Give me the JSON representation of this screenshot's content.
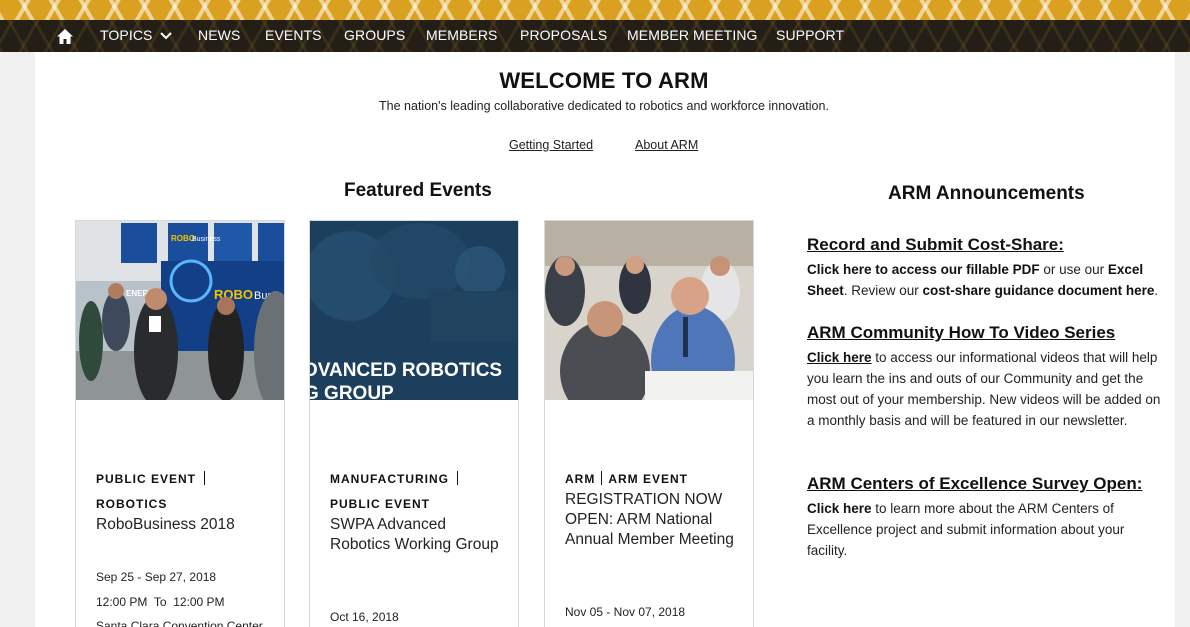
{
  "nav": {
    "items": [
      "TOPICS",
      "NEWS",
      "EVENTS",
      "GROUPS",
      "MEMBERS",
      "PROPOSALS",
      "MEMBER MEETING",
      "SUPPORT"
    ],
    "home_icon": "home-icon",
    "dropdown_icon": "chevron-down-icon"
  },
  "hero": {
    "title": "WELCOME TO ARM",
    "tagline": "The nation's leading collaborative dedicated to robotics and workforce innovation.",
    "links": [
      "Getting Started",
      "About ARM"
    ]
  },
  "featured": {
    "title": "Featured Events",
    "cards": [
      {
        "tags": [
          "PUBLIC EVENT",
          "ROBOTICS"
        ],
        "title": "RoboBusiness 2018",
        "dates": "Sep 25 - Sep 27, 2018",
        "time_start": "12:00 PM",
        "time_to": "To",
        "time_end": "12:00 PM",
        "location": "Santa Clara Convention Center",
        "image_text": [
          "ROBO",
          "Business",
          "ENERGY",
          "ROBO",
          "Busin"
        ]
      },
      {
        "tags": [
          "MANUFACTURING",
          "PUBLIC EVENT"
        ],
        "title": "SWPA Advanced Robotics Working Group",
        "dates": "Oct 16, 2018",
        "image_text": [
          "DVANCED ROBOTICS",
          "G GROUP"
        ]
      },
      {
        "tags": [
          "ARM",
          "ARM EVENT"
        ],
        "title": "REGISTRATION NOW OPEN: ARM National Annual Member Meeting",
        "dates": "Nov 05 - Nov 07, 2018"
      }
    ]
  },
  "announcements": {
    "title": "ARM Announcements",
    "items": [
      {
        "heading": "Record and Submit Cost-Share:",
        "line1_bold": "Click here to access our fillable PDF",
        "line1_rest": " or use our ",
        "line1_bold2": "Excel",
        "line2_bold": "Sheet",
        "line2_rest": ". Review our ",
        "line2_bold2": "cost-share guidance document here",
        "line2_end": "."
      },
      {
        "heading": "ARM Community How To Video Series",
        "link": "Click here",
        "body": " to access our informational videos that will help you learn the ins and outs of our Community and get the most out of your membership. New videos will be added on a monthly basis and will be featured in our newsletter."
      },
      {
        "heading": "ARM Centers of Excellence Survey Open:",
        "link": "Click here",
        "body": " to learn more about the ARM Centers of Excellence project and submit information about your facility."
      }
    ]
  },
  "colors": {
    "band_gold": "#d9a11f",
    "nav_dark": "#231e16",
    "card_overlay_blue": "#1d3f5e"
  }
}
